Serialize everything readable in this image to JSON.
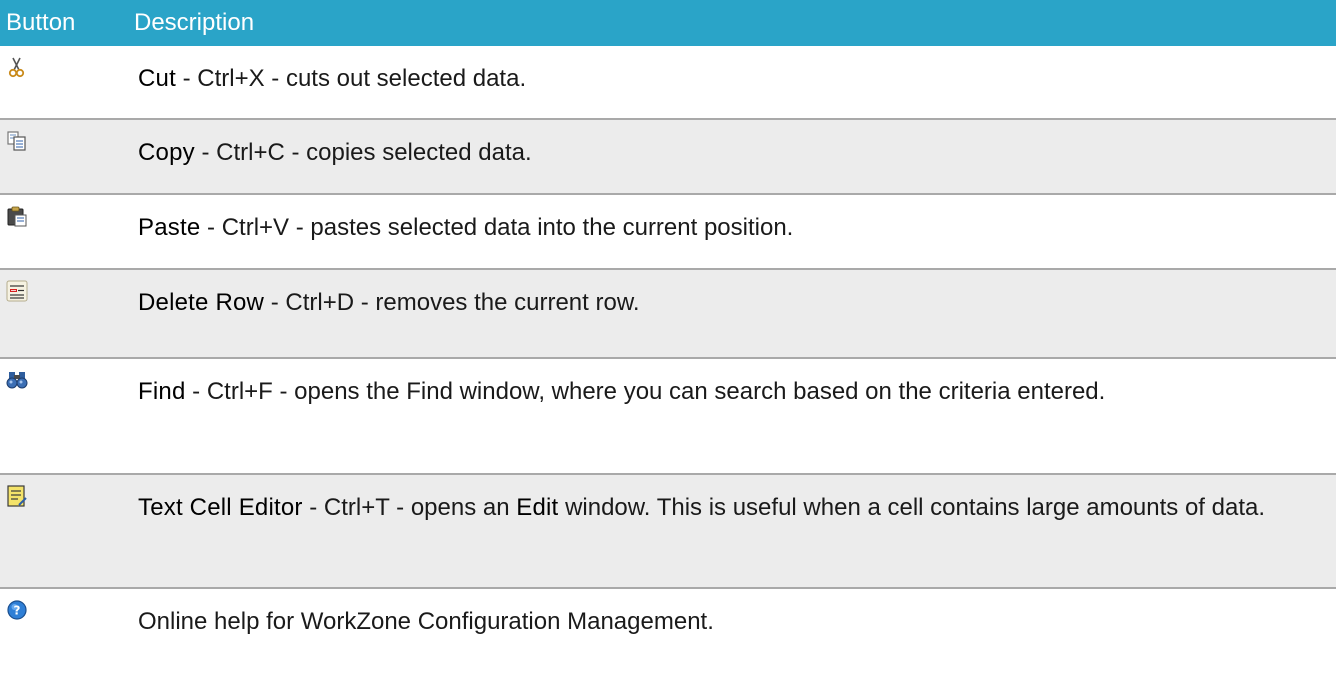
{
  "header": {
    "button_label": "Button",
    "description_label": "Description"
  },
  "rows": [
    {
      "icon": "scissors-icon",
      "name": "Cut",
      "text": " - Ctrl+X - cuts out selected data."
    },
    {
      "icon": "copy-icon",
      "name": "Copy",
      "text": " - Ctrl+C - copies selected data."
    },
    {
      "icon": "paste-icon",
      "name": "Paste",
      "text": " - Ctrl+V - pastes selected data into the current position."
    },
    {
      "icon": "delete-row-icon",
      "name": "Delete Row",
      "text": " - Ctrl+D - removes the current row."
    },
    {
      "icon": "binoculars-icon",
      "name": "Find",
      "text": " - Ctrl+F - opens the Find window, where you can search based on the criteria entered."
    },
    {
      "icon": "text-editor-icon",
      "name": "Text Cell Editor",
      "text_a": " - Ctrl+T - opens an ",
      "name_b": "Edit",
      "text_b": " window. This is useful when a cell contains large amounts of data."
    },
    {
      "icon": "help-icon",
      "text": "Online help for WorkZone Configuration Management."
    }
  ],
  "colors": {
    "header_bg": "#2aa4c8",
    "shaded_row": "#ececec",
    "divider": "#a9a9a9"
  }
}
